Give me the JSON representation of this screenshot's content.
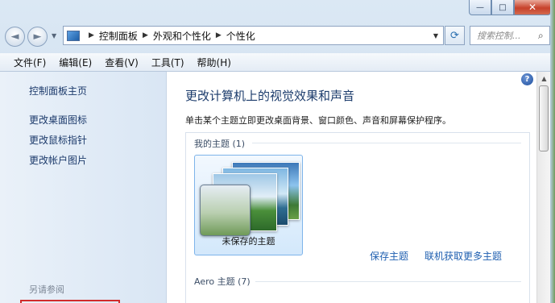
{
  "window": {
    "caption_buttons": {
      "minimize": "—",
      "maximize": "□",
      "close": "✕"
    }
  },
  "nav": {
    "back": "◄",
    "forward": "►",
    "history": "▼"
  },
  "address": {
    "crumbs": [
      "控制面板",
      "外观和个性化",
      "个性化"
    ],
    "separator": "▶",
    "dropdown": "▼",
    "refresh": "⟳"
  },
  "search": {
    "placeholder": "搜索控制...",
    "icon": "search-icon"
  },
  "menu": [
    "文件(F)",
    "编辑(E)",
    "查看(V)",
    "工具(T)",
    "帮助(H)"
  ],
  "left_pane": {
    "links": [
      "控制面板主页",
      "更改桌面图标",
      "更改鼠标指针",
      "更改帐户图片"
    ],
    "see_also": "另请参阅"
  },
  "main": {
    "help": "?",
    "title": "更改计算机上的视觉效果和声音",
    "description": "单击某个主题立即更改桌面背景、窗口颜色、声音和屏幕保护程序。",
    "my_themes_header": "我的主题 (1)",
    "theme_tile_label": "未保存的主题",
    "save_theme": "保存主题",
    "get_more": "联机获取更多主题",
    "aero_header": "Aero 主题 (7)"
  },
  "colors": {
    "link": "#1f5fb0",
    "title": "#1c3c6c",
    "highlight_box": "#d12b2b"
  }
}
